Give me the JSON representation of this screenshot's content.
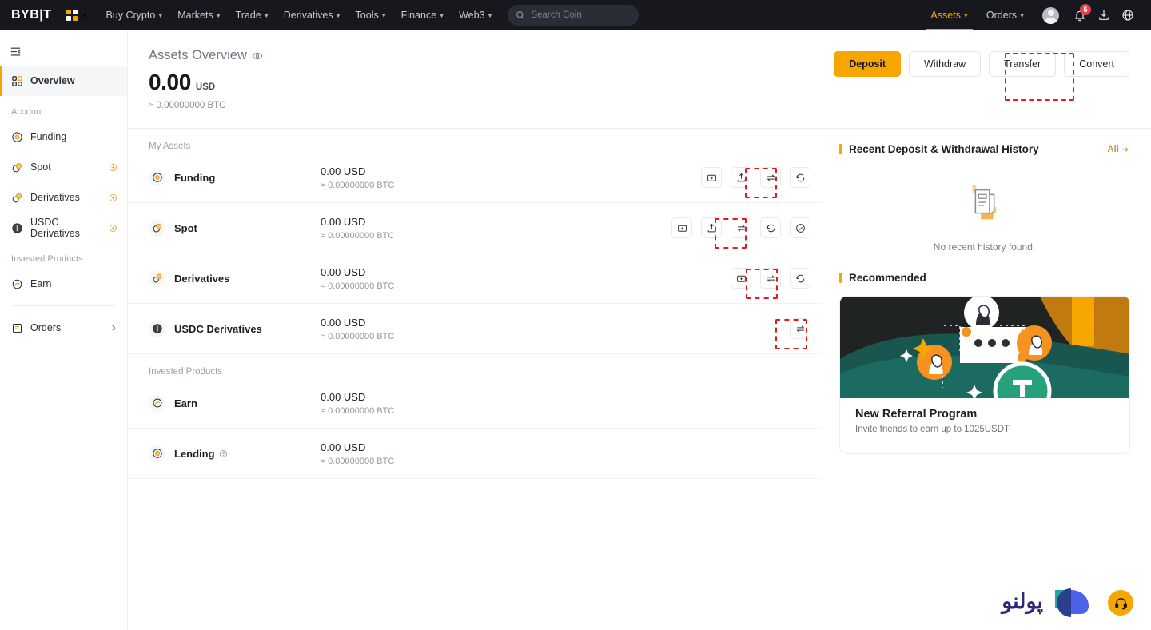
{
  "header": {
    "logo": "BYB|T",
    "apps_icon": "apps-grid-icon",
    "nav": [
      {
        "label": "Buy Crypto",
        "caret": true
      },
      {
        "label": "Markets",
        "caret": true
      },
      {
        "label": "Trade",
        "caret": true
      },
      {
        "label": "Derivatives",
        "caret": true
      },
      {
        "label": "Tools",
        "caret": true
      },
      {
        "label": "Finance",
        "caret": true
      },
      {
        "label": "Web3",
        "caret": true
      }
    ],
    "search": {
      "placeholder": "Search Coin",
      "icon": "search-icon"
    },
    "right_nav": [
      {
        "label": "Assets",
        "caret": true,
        "active": true
      },
      {
        "label": "Orders",
        "caret": true,
        "active": false
      }
    ],
    "notification_count": "5",
    "icons": [
      "avatar",
      "bell-icon",
      "download-icon",
      "globe-icon"
    ]
  },
  "sidebar": {
    "collapse_icon": "collapse-sidebar-icon",
    "overview": {
      "label": "Overview",
      "icon": "dashboard-grid-icon",
      "selected": true
    },
    "group_account": "Account",
    "account_items": [
      {
        "label": "Funding",
        "icon": "funding-coin-icon",
        "badge": false
      },
      {
        "label": "Spot",
        "icon": "spot-coin-icon",
        "badge": true
      },
      {
        "label": "Derivatives",
        "icon": "derivatives-coin-icon",
        "badge": true
      },
      {
        "label": "USDC Derivatives",
        "icon": "usdc-coin-icon",
        "badge": true
      }
    ],
    "group_invested": "Invested Products",
    "invested_items": [
      {
        "label": "Earn",
        "icon": "earn-coin-icon",
        "badge": false
      }
    ],
    "orders": {
      "label": "Orders",
      "icon": "orders-list-icon",
      "chevron": "chevron-right-icon"
    }
  },
  "overview": {
    "title": "Assets Overview",
    "eye_icon": "eye-visibility-icon",
    "balance": "0.00",
    "currency": "USD",
    "balance_btc": "≈ 0.00000000 BTC",
    "buttons": [
      {
        "label": "Deposit",
        "style": "primary",
        "highlighted": false
      },
      {
        "label": "Withdraw",
        "style": "outline",
        "highlighted": false
      },
      {
        "label": "Transfer",
        "style": "outline",
        "highlighted": true
      },
      {
        "label": "Convert",
        "style": "outline",
        "highlighted": false
      }
    ]
  },
  "assets": {
    "my_assets_label": "My Assets",
    "invested_label": "Invested Products",
    "rows": [
      {
        "name": "Funding",
        "icon": "funding-coin-icon",
        "usd": "0.00 USD",
        "btc": "≈ 0.00000000 BTC",
        "help": false,
        "actions": [
          {
            "name": "deposit-icon",
            "highlighted": false
          },
          {
            "name": "withdraw-icon",
            "highlighted": false
          },
          {
            "name": "transfer-icon",
            "highlighted": true
          },
          {
            "name": "convert-icon",
            "highlighted": false
          }
        ]
      },
      {
        "name": "Spot",
        "icon": "spot-coin-icon",
        "usd": "0.00 USD",
        "btc": "≈ 0.00000000 BTC",
        "help": false,
        "actions": [
          {
            "name": "deposit-icon",
            "highlighted": false
          },
          {
            "name": "withdraw-icon",
            "highlighted": false
          },
          {
            "name": "transfer-icon",
            "highlighted": true
          },
          {
            "name": "convert-icon",
            "highlighted": false
          },
          {
            "name": "trade-icon",
            "highlighted": false
          }
        ]
      },
      {
        "name": "Derivatives",
        "icon": "derivatives-coin-icon",
        "usd": "0.00 USD",
        "btc": "≈ 0.00000000 BTC",
        "help": false,
        "actions": [
          {
            "name": "deposit-icon",
            "highlighted": false
          },
          {
            "name": "transfer-icon",
            "highlighted": true
          },
          {
            "name": "convert-icon",
            "highlighted": false
          }
        ]
      },
      {
        "name": "USDC Derivatives",
        "icon": "usdc-coin-icon",
        "usd": "0.00 USD",
        "btc": "≈ 0.00000000 BTC",
        "help": false,
        "actions": [
          {
            "name": "transfer-icon",
            "highlighted": true
          }
        ]
      }
    ],
    "invested_rows": [
      {
        "name": "Earn",
        "icon": "earn-coin-icon",
        "usd": "0.00 USD",
        "btc": "≈ 0.00000000 BTC",
        "help": false,
        "actions": []
      },
      {
        "name": "Lending",
        "icon": "lending-coin-icon",
        "usd": "0.00 USD",
        "btc": "≈ 0.00000000 BTC",
        "help": true,
        "actions": []
      }
    ]
  },
  "right_panel": {
    "history_title": "Recent Deposit & Withdrawal History",
    "all_link": "All",
    "empty_text": "No recent history found.",
    "recommended_title": "Recommended",
    "promo": {
      "heading": "New Referral Program",
      "subtext": "Invite friends to earn up to 1025USDT"
    }
  },
  "watermark": {
    "text": "پولنو",
    "logo": "poolno-logo"
  },
  "support_button": {
    "icon": "headset-support-icon"
  },
  "colors": {
    "brand_orange": "#f7a600",
    "header_bg": "#17181e",
    "highlight_red": "#e01b1b",
    "badge_red": "#e8404a"
  }
}
